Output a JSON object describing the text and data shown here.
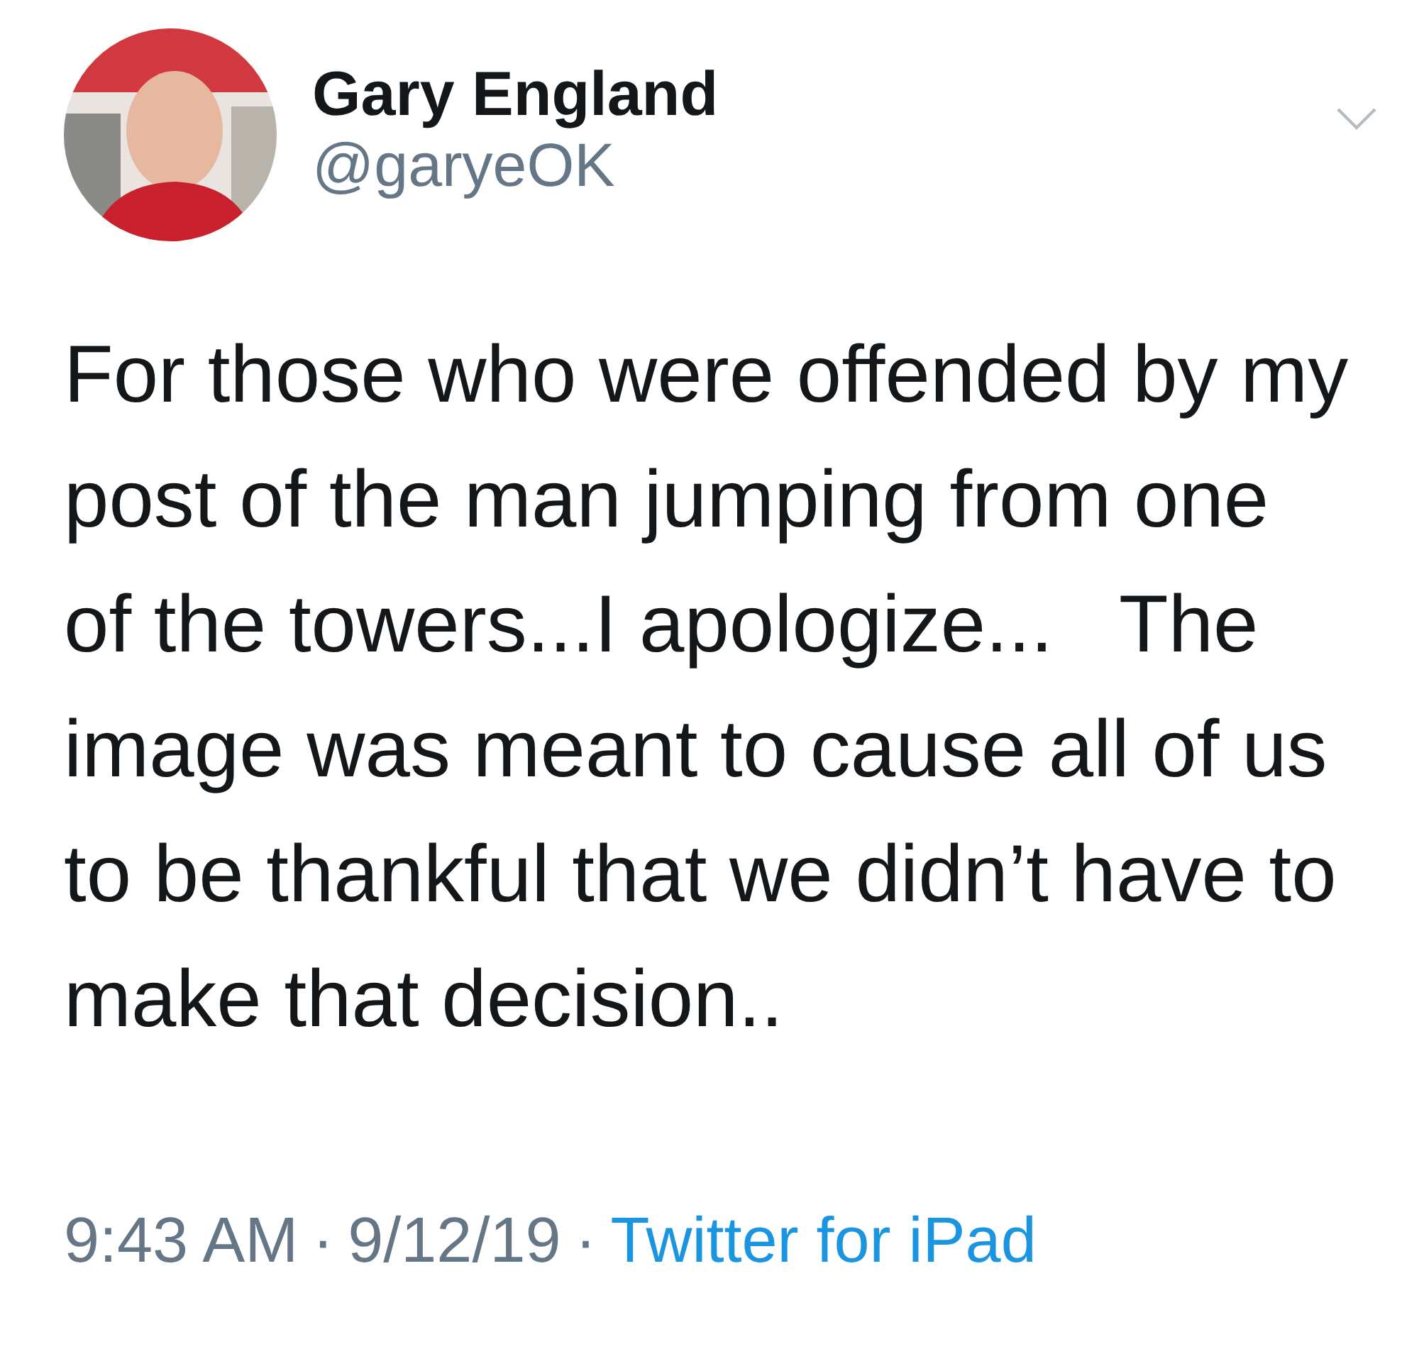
{
  "author": {
    "name": "Gary England",
    "handle": "@garyeOK"
  },
  "tweet": {
    "text": "For those who were offended by my\npost of the man jumping from one\nof the towers...I apologize...   The\nimage was meant to cause all of us\nto be thankful that we didn’t have to\nmake that decision.."
  },
  "meta": {
    "time": "9:43 AM",
    "separator": "·",
    "date": "9/12/19",
    "source": "Twitter for iPad"
  }
}
